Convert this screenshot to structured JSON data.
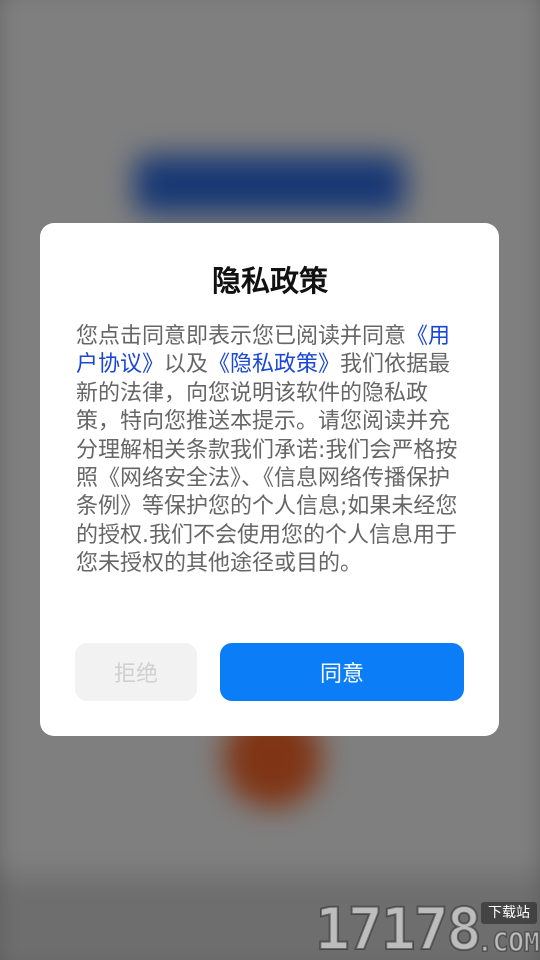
{
  "dialog": {
    "title": "隐私政策",
    "body": {
      "intro": "您点击同意即表示您已阅读并同意",
      "link_user_agreement": "《用户协议》",
      "connector": "以及",
      "link_privacy_policy": "《隐私政策》",
      "rest": "我们依据最新的法律，向您说明该软件的隐私政策，特向您推送本提示。请您阅读并充分理解相关条款我们承诺:我们会严格按照《网络安全法》、《信息网络传播保护条例》等保护您的个人信息;如果未经您的授权.我们不会使用您的个人信息用于您未授权的其他途径或目的。"
    },
    "buttons": {
      "reject": "拒绝",
      "agree": "同意"
    }
  },
  "watermark": {
    "digits": "17178",
    "tag": "下载站",
    "domain": ".COM"
  },
  "colors": {
    "agree_button": "#0a7df7",
    "link": "#1a47d6",
    "reject_button_bg": "#f2f2f2"
  }
}
